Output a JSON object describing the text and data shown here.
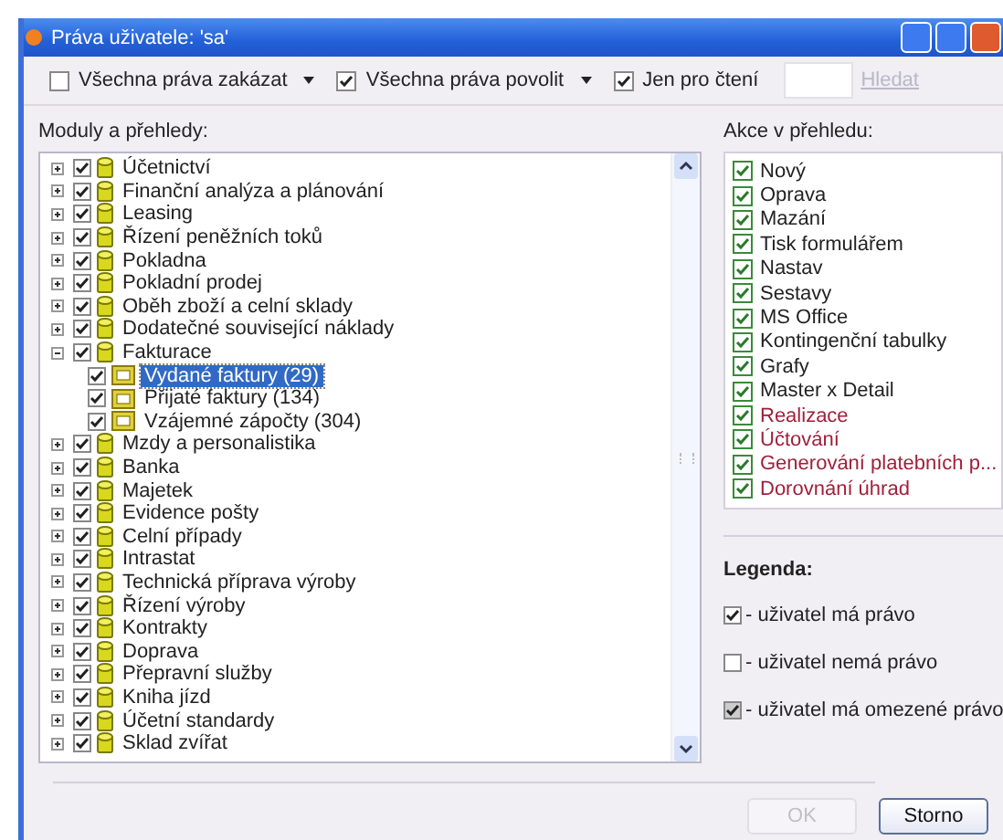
{
  "window": {
    "title": "Práva uživatele: 'sa'"
  },
  "toolbar": {
    "items": [
      {
        "label": "Všechna práva zakázat",
        "checked": false,
        "dropdown": true
      },
      {
        "label": "Všechna práva povolit",
        "checked": true,
        "dropdown": true
      },
      {
        "label": "Jen pro čtení",
        "checked": true,
        "dropdown": false
      }
    ],
    "search": {
      "placeholder": "Hledat"
    }
  },
  "modules": {
    "label": "Moduly a přehledy:",
    "items": [
      {
        "label": "Účetnictví",
        "checked": true,
        "expanded": false
      },
      {
        "label": "Finanční analýza a plánování",
        "checked": true,
        "expanded": false
      },
      {
        "label": "Leasing",
        "checked": true,
        "expanded": false
      },
      {
        "label": "Řízení peněžních toků",
        "checked": true,
        "expanded": false
      },
      {
        "label": "Pokladna",
        "checked": true,
        "expanded": false
      },
      {
        "label": "Pokladní prodej",
        "checked": true,
        "expanded": false
      },
      {
        "label": "Oběh zboží a celní sklady",
        "checked": true,
        "expanded": false
      },
      {
        "label": "Dodatečné související náklady",
        "checked": true,
        "expanded": false
      },
      {
        "label": "Fakturace",
        "checked": true,
        "expanded": true,
        "children": [
          {
            "label": "Vydané faktury (29)",
            "checked": true,
            "selected": true
          },
          {
            "label": "Přijaté faktury (134)",
            "checked": true,
            "selected": false
          },
          {
            "label": "Vzájemné zápočty (304)",
            "checked": true,
            "selected": false
          }
        ]
      },
      {
        "label": "Mzdy a personalistika",
        "checked": true,
        "expanded": false
      },
      {
        "label": "Banka",
        "checked": true,
        "expanded": false
      },
      {
        "label": "Majetek",
        "checked": true,
        "expanded": false
      },
      {
        "label": "Evidence pošty",
        "checked": true,
        "expanded": false
      },
      {
        "label": "Celní případy",
        "checked": true,
        "expanded": false
      },
      {
        "label": "Intrastat",
        "checked": true,
        "expanded": false
      },
      {
        "label": "Technická příprava výroby",
        "checked": true,
        "expanded": false
      },
      {
        "label": "Řízení výroby",
        "checked": true,
        "expanded": false
      },
      {
        "label": "Kontrakty",
        "checked": true,
        "expanded": false
      },
      {
        "label": "Doprava",
        "checked": true,
        "expanded": false
      },
      {
        "label": "Přepravní služby",
        "checked": true,
        "expanded": false
      },
      {
        "label": "Kniha jízd",
        "checked": true,
        "expanded": false
      },
      {
        "label": "Účetní standardy",
        "checked": true,
        "expanded": false
      },
      {
        "label": "Sklad zvířat",
        "checked": true,
        "expanded": false
      }
    ]
  },
  "actions": {
    "label": "Akce v přehledu:",
    "items": [
      {
        "label": "Nový",
        "checked": true,
        "restricted": false
      },
      {
        "label": "Oprava",
        "checked": true,
        "restricted": false
      },
      {
        "label": "Mazání",
        "checked": true,
        "restricted": false
      },
      {
        "label": "Tisk formulářem",
        "checked": true,
        "restricted": false
      },
      {
        "label": "Nastav",
        "checked": true,
        "restricted": false
      },
      {
        "label": "Sestavy",
        "checked": true,
        "restricted": false
      },
      {
        "label": "MS Office",
        "checked": true,
        "restricted": false
      },
      {
        "label": "Kontingenční tabulky",
        "checked": true,
        "restricted": false
      },
      {
        "label": "Grafy",
        "checked": true,
        "restricted": false
      },
      {
        "label": "Master x Detail",
        "checked": true,
        "restricted": false
      },
      {
        "label": "Realizace",
        "checked": true,
        "restricted": true
      },
      {
        "label": "Účtování",
        "checked": true,
        "restricted": true
      },
      {
        "label": "Generování platebních p...",
        "checked": true,
        "restricted": true
      },
      {
        "label": "Dorovnání úhrad",
        "checked": true,
        "restricted": true
      }
    ]
  },
  "legend": {
    "title": "Legenda:",
    "items": [
      {
        "kind": "checked",
        "label": "- uživatel má právo"
      },
      {
        "kind": "unchecked",
        "label": "- uživatel nemá právo"
      },
      {
        "kind": "partial",
        "label": "- uživatel má omezené právo"
      }
    ]
  },
  "buttons": [
    {
      "label": "OK",
      "disabled": true
    },
    {
      "label": "Storno",
      "disabled": false
    }
  ]
}
